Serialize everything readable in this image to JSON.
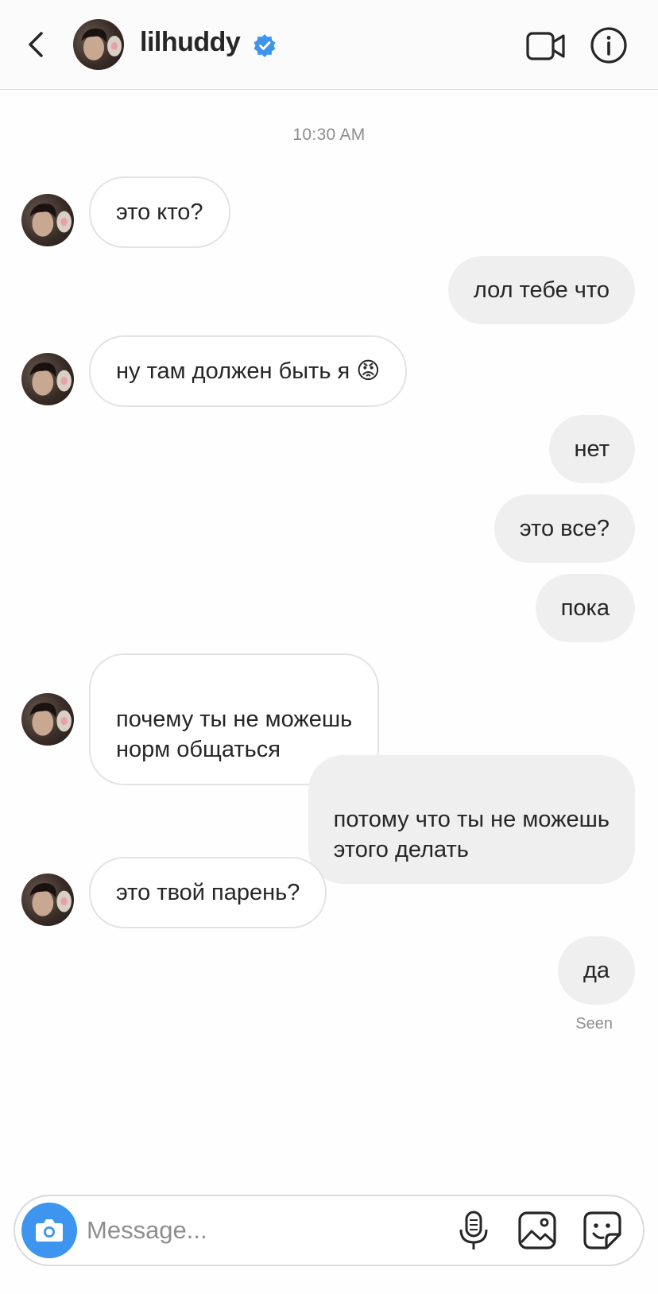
{
  "header": {
    "username": "lilhuddy",
    "verified": true,
    "accent_color": "#3d95f0"
  },
  "conversation": {
    "timestamp": "10:30 AM",
    "messages": [
      {
        "from": "them",
        "text": "это кто?"
      },
      {
        "from": "me",
        "text": "лол тебе что"
      },
      {
        "from": "them",
        "text": "ну там должен быть я 😡"
      },
      {
        "from": "me",
        "text": "нет"
      },
      {
        "from": "me",
        "text": "это все?"
      },
      {
        "from": "me",
        "text": "пока"
      },
      {
        "from": "them",
        "text": "почему ты не можешь\nнорм общаться"
      },
      {
        "from": "me",
        "text": "потому что ты не можешь\nэтого делать"
      },
      {
        "from": "them",
        "text": "это твой парень?"
      },
      {
        "from": "me",
        "text": "да"
      }
    ],
    "seen_label": "Seen"
  },
  "composer": {
    "placeholder": "Message...",
    "icons": [
      "camera-icon",
      "microphone-icon",
      "gallery-icon",
      "sticker-icon"
    ]
  },
  "colors": {
    "incoming_bubble": "#ffffff",
    "outgoing_bubble": "#efefef",
    "camera_button": "#3d95f0"
  }
}
